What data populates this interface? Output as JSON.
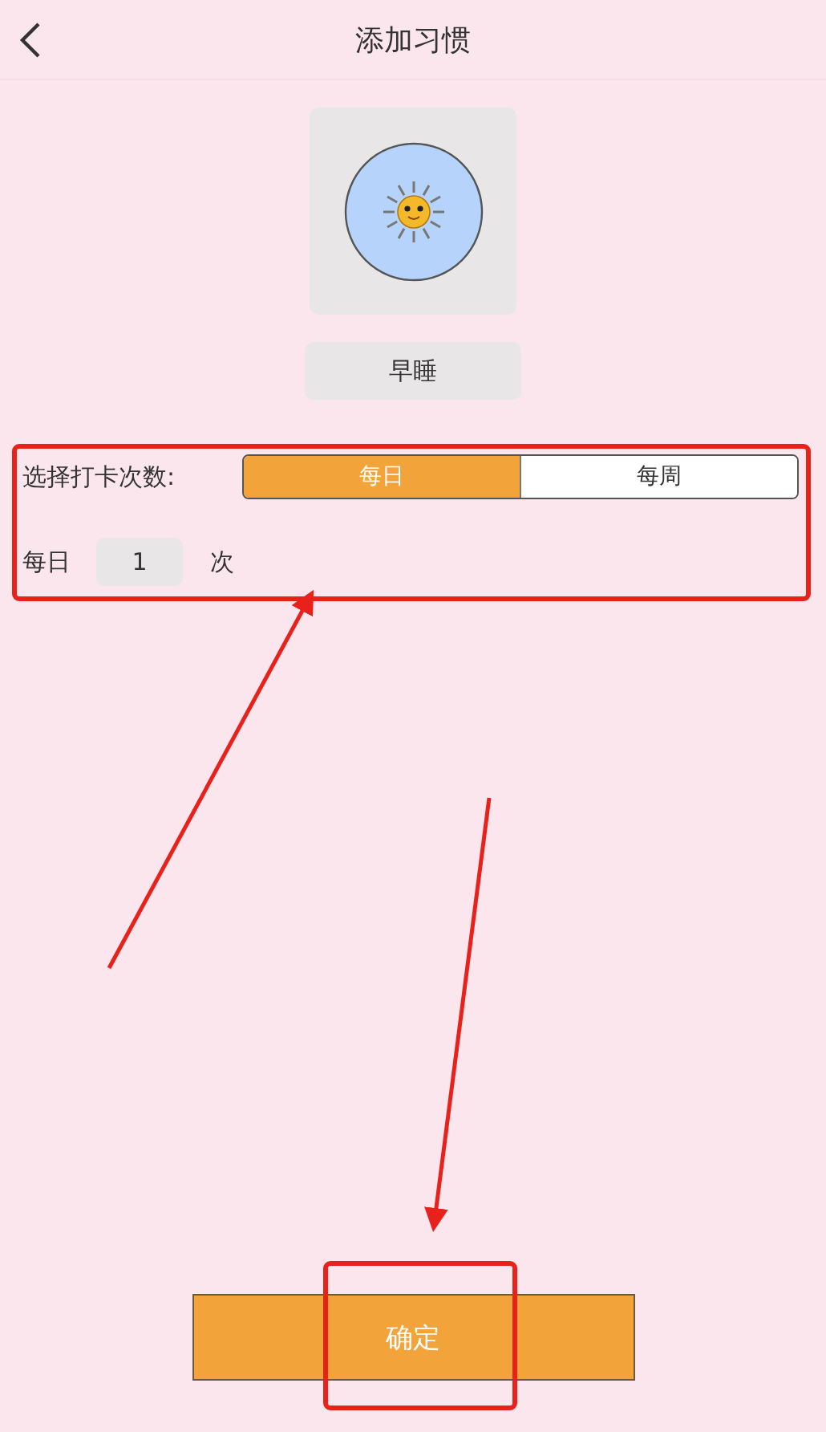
{
  "header": {
    "title": "添加习惯"
  },
  "habit": {
    "name": "早睡"
  },
  "frequency": {
    "label": "选择打卡次数:",
    "options": [
      {
        "label": "每日",
        "selected": true
      },
      {
        "label": "每周",
        "selected": false
      }
    ]
  },
  "count": {
    "prefix": "每日",
    "value": "1",
    "suffix": "次"
  },
  "confirm_button": "确定"
}
